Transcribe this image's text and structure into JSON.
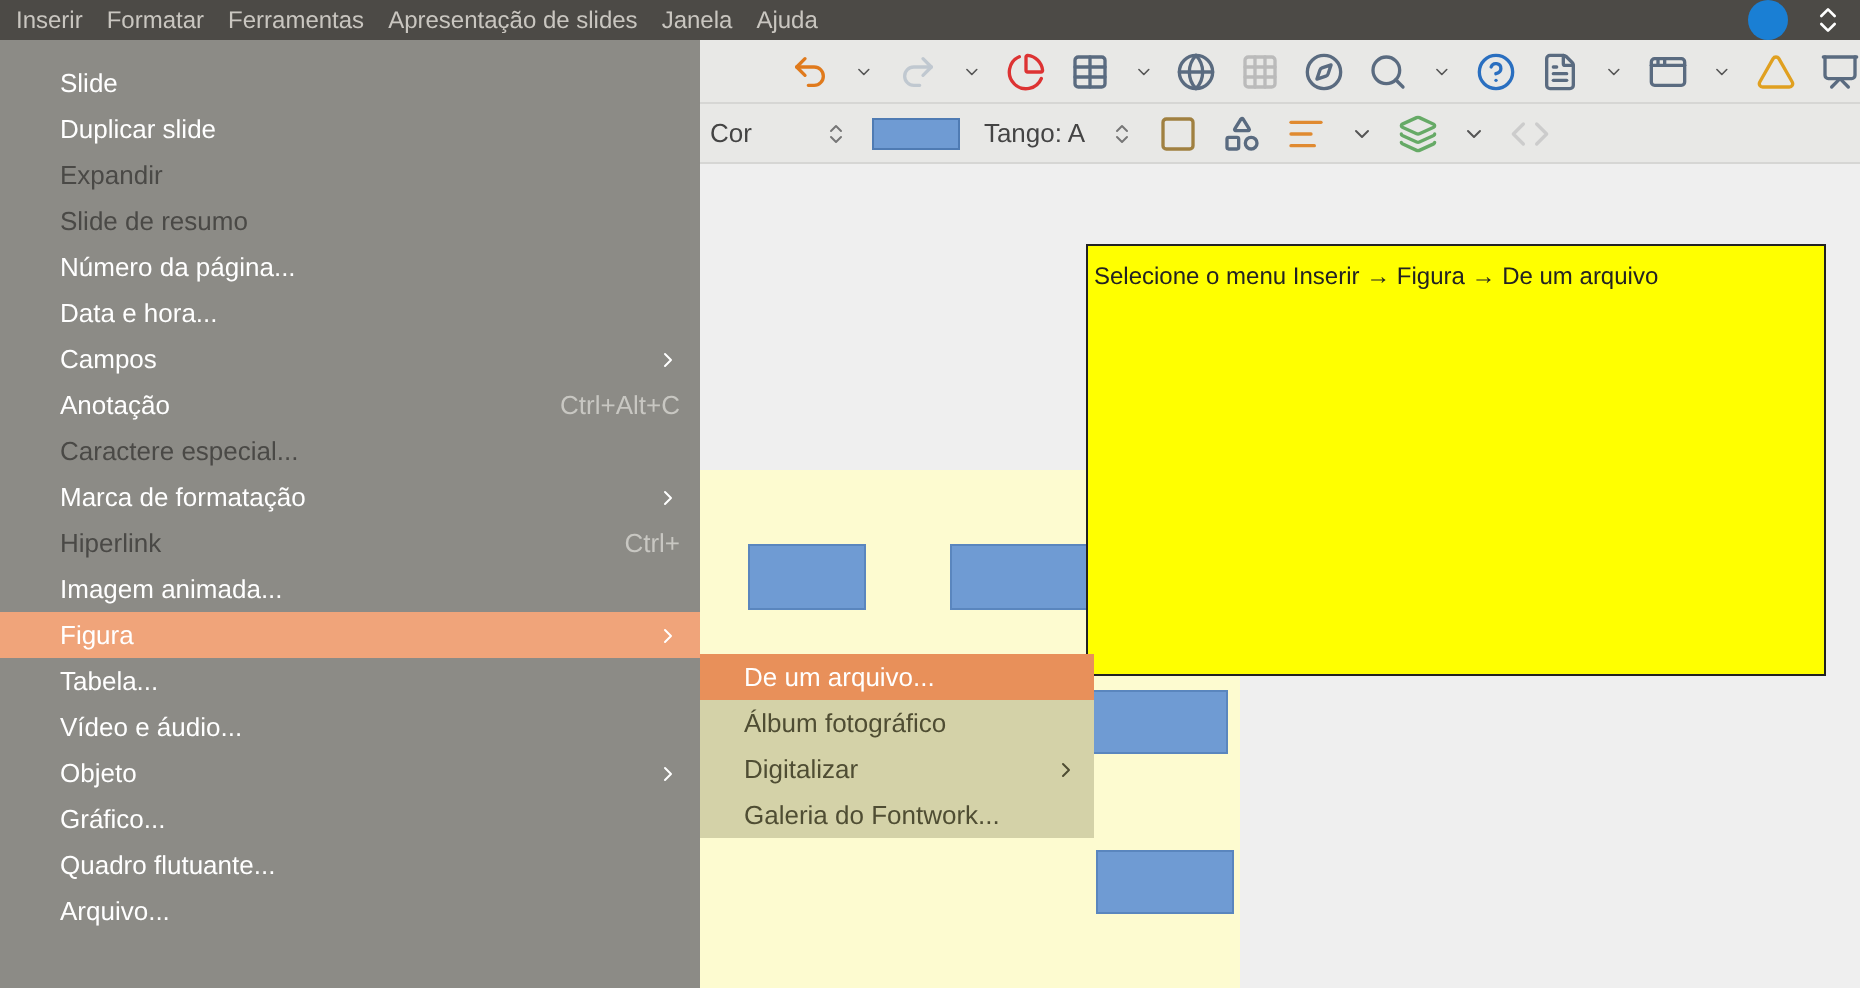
{
  "menubar": [
    "Inserir",
    "Formatar",
    "Ferramentas",
    "Apresentação de slides",
    "Janela",
    "Ajuda"
  ],
  "insert_menu": {
    "items": [
      {
        "label": "Slide",
        "disabled": false,
        "selected": false,
        "submenu": false
      },
      {
        "label": "Duplicar slide",
        "disabled": false,
        "selected": false,
        "submenu": false
      },
      {
        "label": "Expandir",
        "disabled": true,
        "selected": false,
        "submenu": false
      },
      {
        "label": "Slide de resumo",
        "disabled": true,
        "selected": false,
        "submenu": false
      },
      {
        "label": "Número da página...",
        "disabled": false,
        "selected": false,
        "submenu": false
      },
      {
        "label": "Data e hora...",
        "disabled": false,
        "selected": false,
        "submenu": false
      },
      {
        "label": "Campos",
        "disabled": false,
        "selected": false,
        "submenu": true
      },
      {
        "label": "Anotação",
        "shortcut": "Ctrl+Alt+C",
        "disabled": false,
        "selected": false,
        "submenu": false
      },
      {
        "label": "Caractere especial...",
        "disabled": true,
        "selected": false,
        "submenu": false
      },
      {
        "label": "Marca de formatação",
        "disabled": false,
        "selected": false,
        "submenu": true
      },
      {
        "label": "Hiperlink",
        "shortcut": "Ctrl+",
        "disabled": true,
        "selected": false,
        "submenu": false
      },
      {
        "label": "Imagem animada...",
        "disabled": false,
        "selected": false,
        "submenu": false
      },
      {
        "label": "Figura",
        "disabled": false,
        "selected": true,
        "submenu": true
      },
      {
        "label": "Tabela...",
        "disabled": false,
        "selected": false,
        "submenu": false
      },
      {
        "label": "Vídeo e áudio...",
        "disabled": false,
        "selected": false,
        "submenu": false
      },
      {
        "label": "Objeto",
        "disabled": false,
        "selected": false,
        "submenu": true
      },
      {
        "label": "Gráfico...",
        "disabled": false,
        "selected": false,
        "submenu": false
      },
      {
        "label": "Quadro flutuante...",
        "disabled": false,
        "selected": false,
        "submenu": false
      },
      {
        "label": "Arquivo...",
        "disabled": false,
        "selected": false,
        "submenu": false
      }
    ]
  },
  "figure_submenu": {
    "items": [
      {
        "label": "De um arquivo...",
        "selected": true,
        "submenu": false
      },
      {
        "label": "Álbum fotográfico",
        "selected": false,
        "submenu": false
      },
      {
        "label": "Digitalizar",
        "selected": false,
        "submenu": true
      },
      {
        "label": "Galeria do Fontwork...",
        "selected": false,
        "submenu": false
      }
    ]
  },
  "toolbar": {
    "fill_label": "Cor",
    "palette": "Tango: A"
  },
  "note": {
    "text": "Selecione o menu Inserir → Figura → De um arquivo"
  }
}
